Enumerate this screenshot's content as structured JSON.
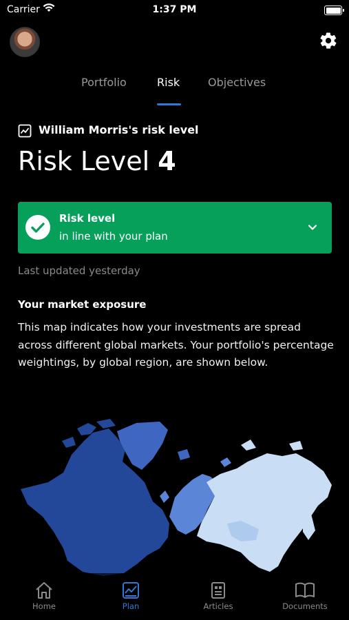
{
  "status_bar": {
    "carrier": "Carrier",
    "time": "1:37 PM"
  },
  "tabs": [
    {
      "label": "Portfolio",
      "active": false
    },
    {
      "label": "Risk",
      "active": true
    },
    {
      "label": "Objectives",
      "active": false
    }
  ],
  "risk": {
    "heading": "William Morris's risk level",
    "level_prefix": "Risk Level",
    "level_value": "4",
    "card_title": "Risk level",
    "card_subtitle": "in line with your plan",
    "card_color": "#06a05a",
    "last_updated": "Last updated yesterday"
  },
  "exposure": {
    "title": "Your market exposure",
    "body": "This map indicates how your investments are spread across different global markets. Your portfolio's percentage weightings, by global region, are shown below."
  },
  "map": {
    "region_colors": {
      "north_america": "#23489a",
      "greenland": "#3f66c0",
      "europe": "#5b86d8",
      "asia": "#c9ddf5"
    }
  },
  "tab_bar": {
    "items": [
      {
        "label": "Home",
        "icon": "home-icon",
        "active": false
      },
      {
        "label": "Plan",
        "icon": "plan-chart-icon",
        "active": true
      },
      {
        "label": "Articles",
        "icon": "articles-icon",
        "active": false
      },
      {
        "label": "Documents",
        "icon": "documents-icon",
        "active": false
      }
    ],
    "active_color": "#2f7ad6"
  }
}
